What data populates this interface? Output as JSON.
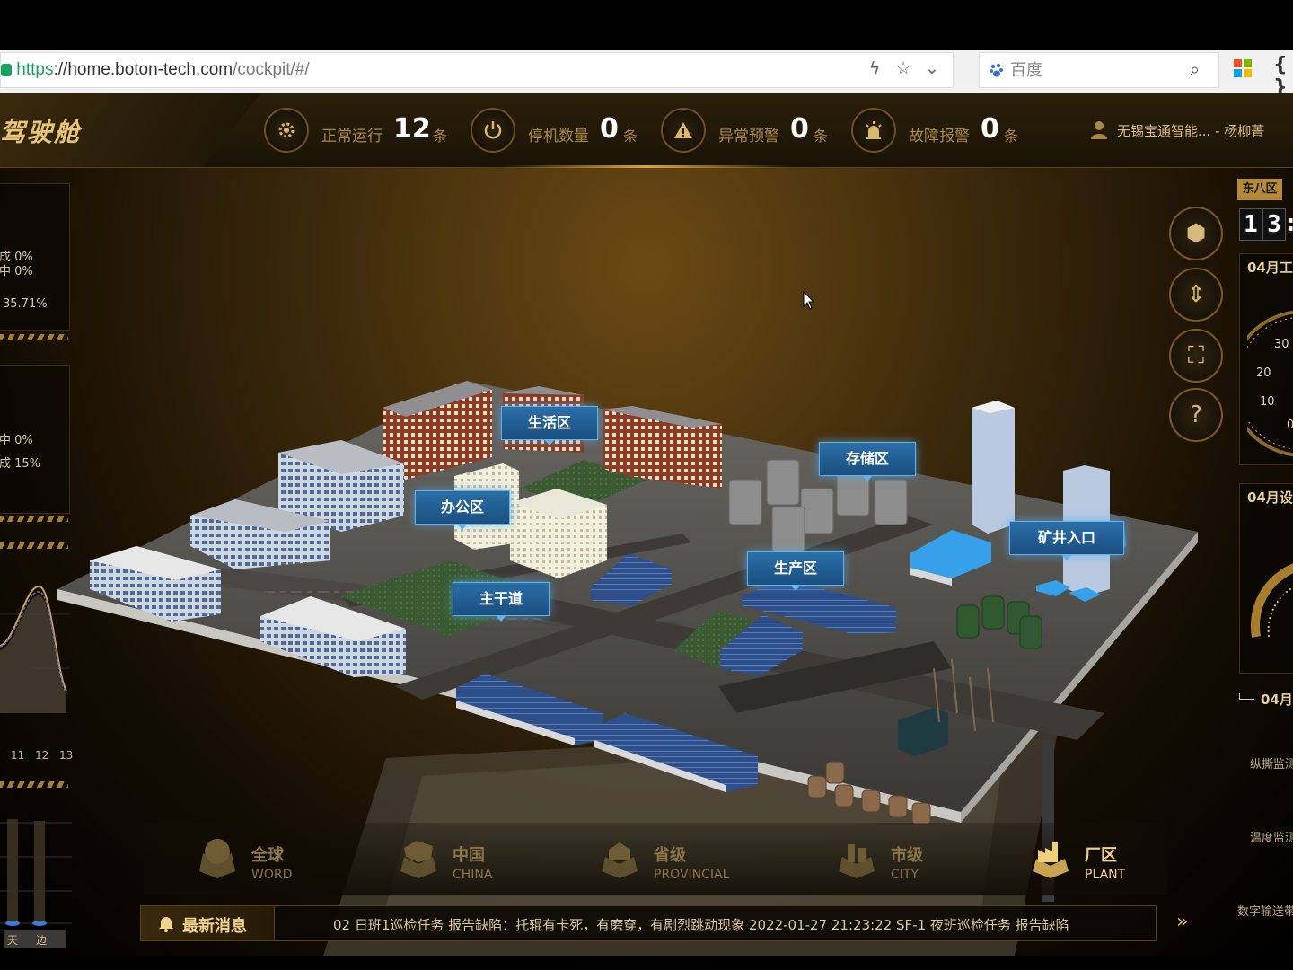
{
  "browser": {
    "url_scheme": "https",
    "url_host": "://home.boton-tech.com",
    "url_path": "/cockpit/#/",
    "search_placeholder": "百度",
    "braces": "{ }"
  },
  "header": {
    "title": "驾驶舱",
    "stats": [
      {
        "label": "正常运行",
        "value": "12",
        "unit": "条"
      },
      {
        "label": "停机数量",
        "value": "0",
        "unit": "条"
      },
      {
        "label": "异常预警",
        "value": "0",
        "unit": "条"
      },
      {
        "label": "故障报警",
        "value": "0",
        "unit": "条"
      }
    ],
    "user": "无锡宝通智能...   - 杨柳菁"
  },
  "left_panels": {
    "panel1": {
      "line1": "成 0%",
      "line2": "中 0%",
      "line3": "35.71%"
    },
    "panel2": {
      "line1": "中 0%",
      "line2": "成 15%"
    },
    "chart_ticks": [
      "11",
      "12",
      "13"
    ],
    "bottom_labels": [
      "天",
      "边"
    ]
  },
  "right_panels": {
    "timezone": "东八区",
    "clock_digits": [
      "1",
      "3"
    ],
    "panel1_title": "04月工",
    "gauge_ticks": [
      "30",
      "20",
      "10",
      "0"
    ],
    "panel2_title": "04月设",
    "legend_label": "04月",
    "labels": [
      "纵撕监测",
      "温度监测",
      "数字输送带"
    ]
  },
  "tools": [
    "3d-view",
    "elevation",
    "fit-view",
    "help"
  ],
  "tool_help_label": "?",
  "zones": [
    {
      "label": "生活区"
    },
    {
      "label": "办公区"
    },
    {
      "label": "主干道"
    },
    {
      "label": "存储区"
    },
    {
      "label": "生产区"
    },
    {
      "label": "矿井入口"
    }
  ],
  "nav": [
    {
      "zh": "全球",
      "en": "WORD",
      "active": false
    },
    {
      "zh": "中国",
      "en": "CHINA",
      "active": false
    },
    {
      "zh": "省级",
      "en": "PROVINCIAL",
      "active": false
    },
    {
      "zh": "市级",
      "en": "CITY",
      "active": false
    },
    {
      "zh": "厂区",
      "en": "PLANT",
      "active": true
    }
  ],
  "news": {
    "label": "最新消息",
    "text": "02 日班1巡检任务 报告缺陷：托辊有卡死，有磨穿，有剧烈跳动现象      2022-01-27 21:23:22 SF-1 夜班巡检任务 报告缺陷",
    "arrow": "»"
  },
  "colors": {
    "gold": "#c9a85c",
    "accent": "#f0d48e",
    "zone_blue": "#2a6fa8"
  }
}
